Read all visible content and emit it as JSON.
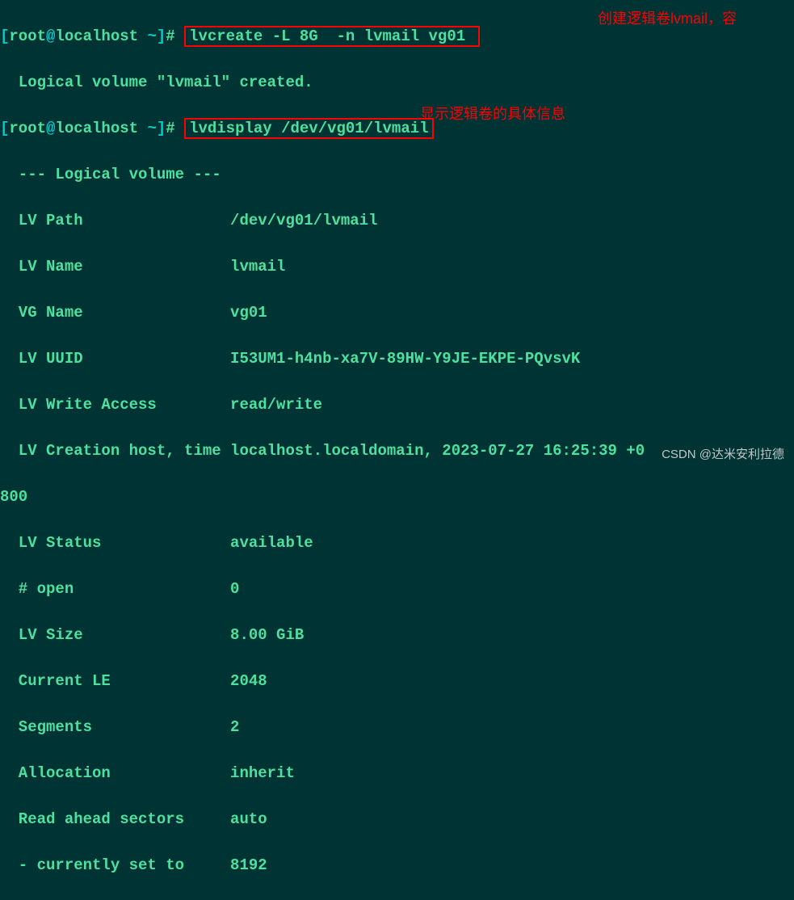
{
  "prompt1": {
    "open": "[",
    "user": "root",
    "at": "@",
    "host": "localhost",
    "space": " ",
    "path": "~",
    "close": "]",
    "hash": "# "
  },
  "cmd1": "lvcreate -L 8G  -n lvmail vg01 ",
  "out1": "  Logical volume \"lvmail\" created.",
  "prompt2": {
    "open": "[",
    "user": "root",
    "at": "@",
    "host": "localhost",
    "space": " ",
    "path": "~",
    "close": "]",
    "hash": "# "
  },
  "cmd2": "lvdisplay /dev/vg01/lvmail",
  "header": "  --- Logical volume ---",
  "rows": {
    "r1a": "  LV Path                ",
    "r1b": "/dev/vg01/lvmail",
    "r2a": "  LV Name                ",
    "r2b": "lvmail",
    "r3a": "  VG Name                ",
    "r3b": "vg01",
    "r4a": "  LV UUID                ",
    "r4b": "I53UM1-h4nb-xa7V-89HW-Y9JE-EKPE-PQvsvK",
    "r5a": "  LV Write Access        ",
    "r5b": "read/write",
    "r6a": "  LV Creation host, time ",
    "r6b": "localhost.localdomain, 2023-07-27 16:25:39 +0",
    "r6c": "800",
    "r7a": "  LV Status              ",
    "r7b": "available",
    "r8a": "  # open                 ",
    "r8b": "0",
    "r9a": "  LV Size                ",
    "r9b": "8.00 GiB",
    "r10a": "  Current LE             ",
    "r10b": "2048",
    "r11a": "  Segments               ",
    "r11b": "2",
    "r12a": "  Allocation             ",
    "r12b": "inherit",
    "r13a": "  Read ahead sectors     ",
    "r13b": "auto",
    "r14a": "  - currently set to     ",
    "r14b": "8192"
  },
  "anno1": "创建逻辑卷lvmail，容",
  "anno2": "显示逻辑卷的具体信息",
  "watermark": "CSDN @达米安利拉德"
}
